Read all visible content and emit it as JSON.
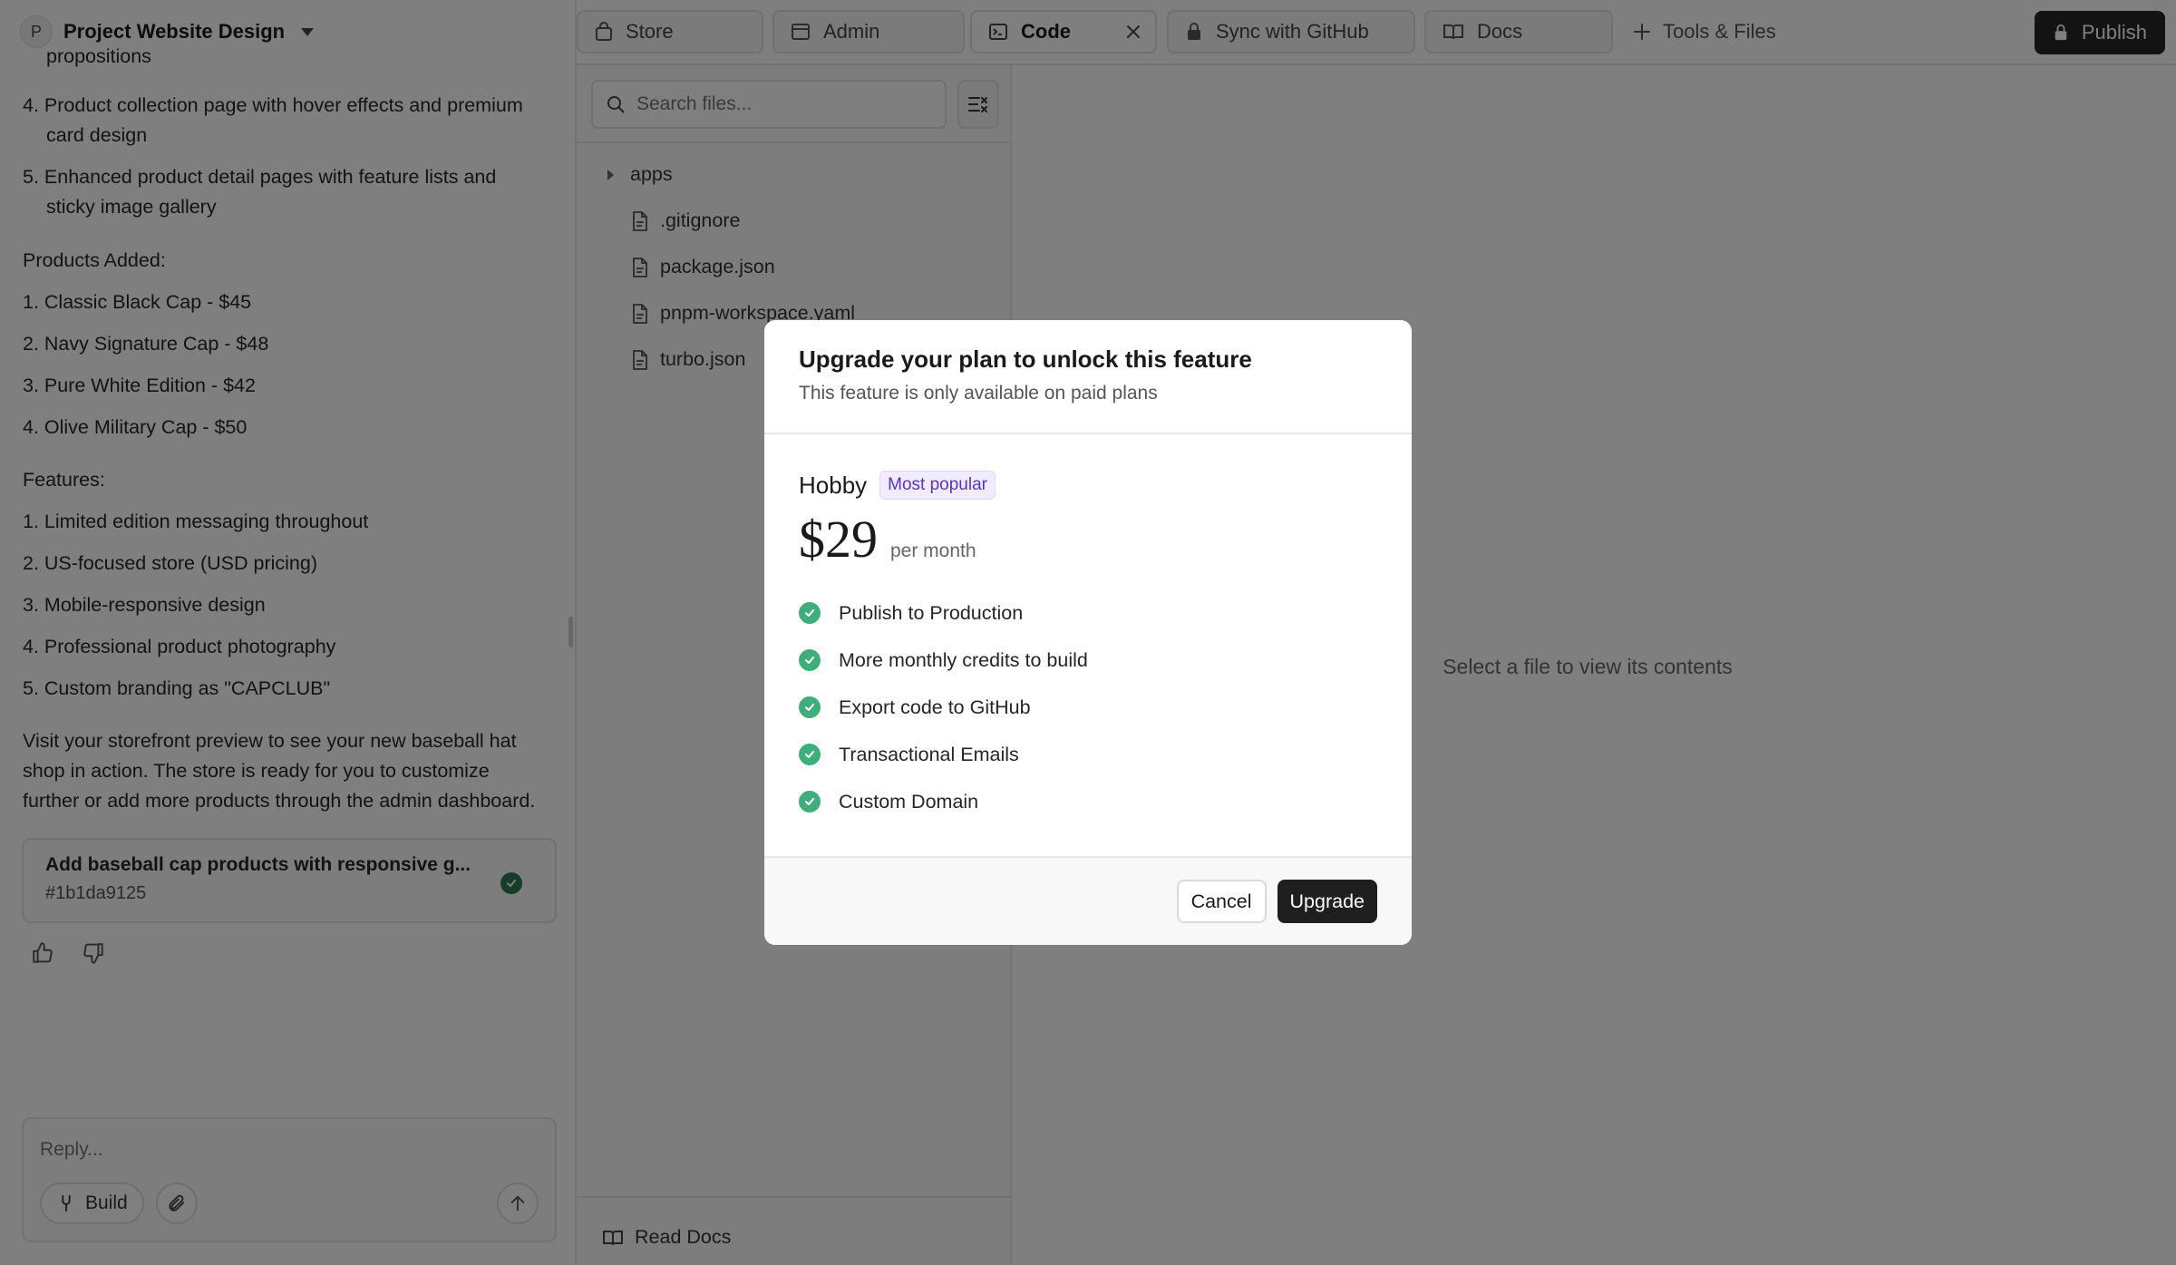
{
  "project": {
    "avatar_letter": "P",
    "name": "Project Website Design"
  },
  "chat": {
    "partial_top": "propositions",
    "items_pre": [
      "4. Product collection page with hover effects and premium",
      "card design",
      "5. Enhanced product detail pages with feature lists and",
      "sticky image gallery"
    ],
    "products_heading": "Products Added:",
    "products": [
      "1. Classic Black Cap - $45",
      "2. Navy Signature Cap - $48",
      "3. Pure White Edition - $42",
      "4. Olive Military Cap - $50"
    ],
    "features_heading": "Features:",
    "features": [
      "1. Limited edition messaging throughout",
      "2. US-focused store (USD pricing)",
      "3. Mobile-responsive design",
      "4. Professional product photography",
      "5. Custom branding as \"CAPCLUB\""
    ],
    "closing": [
      "Visit your storefront preview to see your new baseball hat",
      "shop in action. The store is ready for you to customize",
      "further or add more products through the admin dashboard."
    ],
    "commit": {
      "title": "Add baseball cap products with responsive g...",
      "hash": "#1b1da9125"
    }
  },
  "reply": {
    "placeholder": "Reply...",
    "build_label": "Build"
  },
  "tabs": [
    {
      "label": "Store",
      "icon": "bag-icon"
    },
    {
      "label": "Admin",
      "icon": "window-icon"
    },
    {
      "label": "Code",
      "icon": "terminal-icon"
    },
    {
      "label": "Sync with GitHub",
      "icon": "lock-icon"
    },
    {
      "label": "Docs",
      "icon": "book-icon"
    }
  ],
  "tools_files_label": "Tools & Files",
  "publish_label": "Publish",
  "file_tree": {
    "search_placeholder": "Search files...",
    "items": [
      {
        "name": "apps",
        "type": "folder"
      },
      {
        "name": ".gitignore",
        "type": "file"
      },
      {
        "name": "package.json",
        "type": "file"
      },
      {
        "name": "pnpm-workspace.yaml",
        "type": "file"
      },
      {
        "name": "turbo.json",
        "type": "file"
      }
    ],
    "read_docs_label": "Read Docs"
  },
  "viewer": {
    "empty_message": "Select a file to view its contents"
  },
  "modal": {
    "title": "Upgrade your plan to unlock this feature",
    "subtitle": "This feature is only available on paid plans",
    "plan_name": "Hobby",
    "badge": "Most popular",
    "price": "$29",
    "price_unit": "per month",
    "features": [
      "Publish to Production",
      "More monthly credits to build",
      "Export code to GitHub",
      "Transactional Emails",
      "Custom Domain"
    ],
    "cancel_label": "Cancel",
    "upgrade_label": "Upgrade"
  },
  "colors": {
    "accent_check": "#3fae7a",
    "badge_bg": "#f1ebff",
    "badge_text": "#5b34b8",
    "primary_button": "#1f1f1f"
  }
}
